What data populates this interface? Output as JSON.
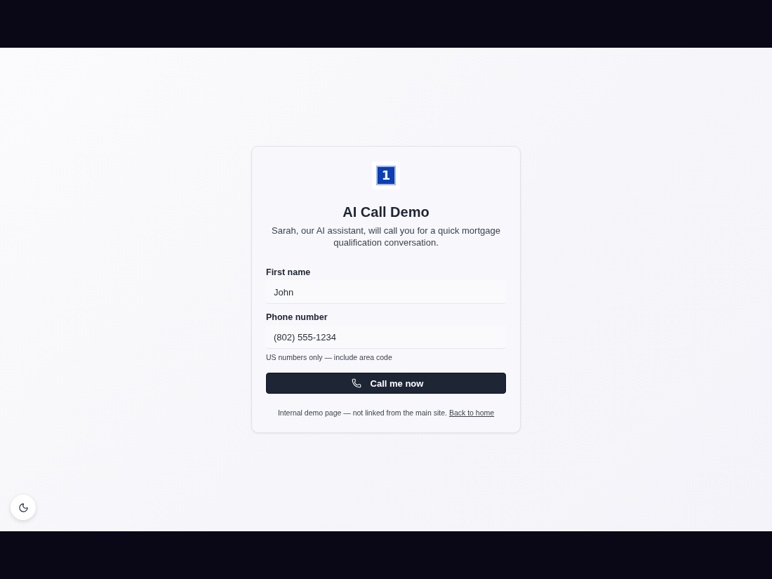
{
  "logo": {
    "text": "1"
  },
  "title": "AI Call Demo",
  "subtitle": "Sarah, our AI assistant, will call you for a quick mortgage qualification conversation.",
  "fields": [
    {
      "label": "First name",
      "value": "John"
    },
    {
      "label": "Phone number",
      "value": "(802) 555-1234",
      "hint": "US numbers only — include area code"
    }
  ],
  "submit_button": {
    "label": "Call me now"
  },
  "footer": {
    "note": "Internal demo page — not linked from the main site.",
    "link": "Back to home"
  }
}
